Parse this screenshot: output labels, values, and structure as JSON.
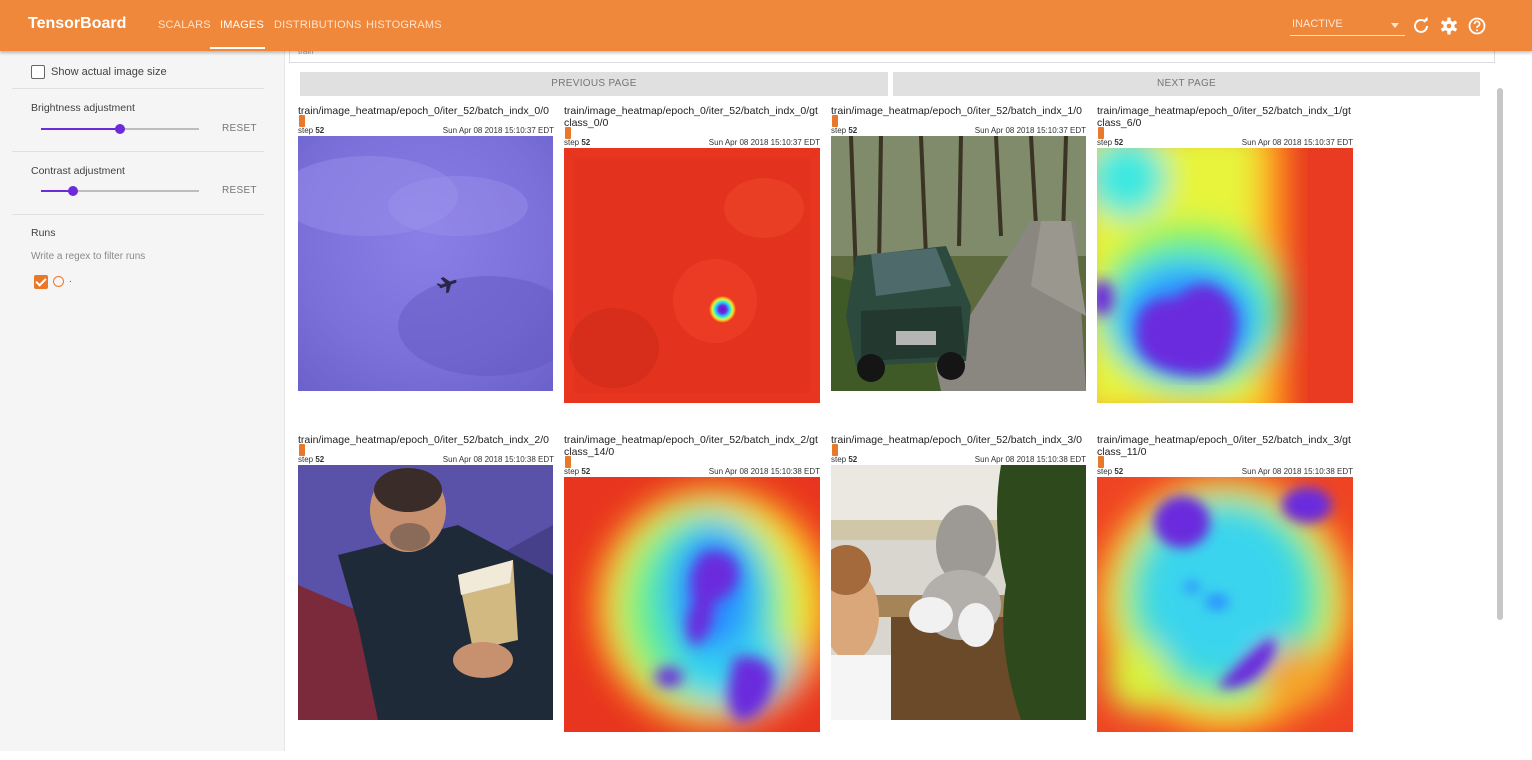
{
  "app": {
    "brand": "TensorBoard",
    "tabs": [
      {
        "label": "SCALARS"
      },
      {
        "label": "IMAGES"
      },
      {
        "label": "DISTRIBUTIONS"
      },
      {
        "label": "HISTOGRAMS"
      }
    ],
    "active_tab": "IMAGES",
    "run_selector": "INACTIVE",
    "accent_color": "#f0883b"
  },
  "sidebar": {
    "show_actual_size": "Show actual image size",
    "brightness": {
      "label": "Brightness adjustment",
      "reset": "RESET",
      "value": 0.5
    },
    "contrast": {
      "label": "Contrast adjustment",
      "reset": "RESET",
      "value": 0.2
    },
    "runs": {
      "title": "Runs",
      "filter_placeholder": "Write a regex to filter runs",
      "run_name": "."
    }
  },
  "main": {
    "section_label": "train",
    "prev_page": "PREVIOUS PAGE",
    "next_page": "NEXT PAGE",
    "cards": [
      {
        "tag": "train/image_heatmap/epoch_0/iter_52/batch_indx_0/0",
        "step_label": "step",
        "step": "52",
        "wall_time": "Sun Apr 08 2018 15:10:37 EDT",
        "kind": "sky"
      },
      {
        "tag": "train/image_heatmap/epoch_0/iter_52/batch_indx_0/gt",
        "tag2": "class_0/0",
        "step_label": "step",
        "step": "52",
        "wall_time": "Sun Apr 08 2018 15:10:37 EDT",
        "kind": "heat1"
      },
      {
        "tag": "train/image_heatmap/epoch_0/iter_52/batch_indx_1/0",
        "step_label": "step",
        "step": "52",
        "wall_time": "Sun Apr 08 2018 15:10:37 EDT",
        "kind": "car"
      },
      {
        "tag": "train/image_heatmap/epoch_0/iter_52/batch_indx_1/gt",
        "tag2": "class_6/0",
        "step_label": "step",
        "step": "52",
        "wall_time": "Sun Apr 08 2018 15:10:37 EDT",
        "kind": "heat2"
      },
      {
        "tag": "train/image_heatmap/epoch_0/iter_52/batch_indx_2/0",
        "step_label": "step",
        "step": "52",
        "wall_time": "Sun Apr 08 2018 15:10:38 EDT",
        "kind": "man"
      },
      {
        "tag": "train/image_heatmap/epoch_0/iter_52/batch_indx_2/gt",
        "tag2": "class_14/0",
        "step_label": "step",
        "step": "52",
        "wall_time": "Sun Apr 08 2018 15:10:38 EDT",
        "kind": "heat3"
      },
      {
        "tag": "train/image_heatmap/epoch_0/iter_52/batch_indx_3/0",
        "step_label": "step",
        "step": "52",
        "wall_time": "Sun Apr 08 2018 15:10:38 EDT",
        "kind": "dog"
      },
      {
        "tag": "train/image_heatmap/epoch_0/iter_52/batch_indx_3/gt",
        "tag2": "class_11/0",
        "step_label": "step",
        "step": "52",
        "wall_time": "Sun Apr 08 2018 15:10:38 EDT",
        "kind": "heat4"
      }
    ]
  }
}
